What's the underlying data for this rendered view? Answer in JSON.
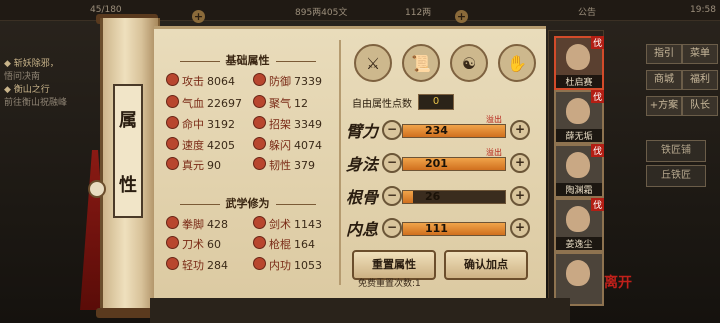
{
  "topbar": {
    "left_stat": "45/180",
    "currency": "895两405文",
    "coins": "112两",
    "notice_label": "公告",
    "time": "19:58"
  },
  "quest_panel": {
    "items": [
      {
        "title": "斩妖除邪，",
        "sub": "悟问决南"
      },
      {
        "title": "衡山之行",
        "sub": "前往衡山祝融峰"
      }
    ]
  },
  "scroll_title": [
    "属",
    "性"
  ],
  "basic_attrs": {
    "title": "基础属性",
    "left": [
      {
        "label": "攻击",
        "value": "8064"
      },
      {
        "label": "气血",
        "value": "22697"
      },
      {
        "label": "命中",
        "value": "3192"
      },
      {
        "label": "速度",
        "value": "4205"
      },
      {
        "label": "真元",
        "value": "90"
      }
    ],
    "right": [
      {
        "label": "防御",
        "value": "7339"
      },
      {
        "label": "聚气",
        "value": "12"
      },
      {
        "label": "招架",
        "value": "3349"
      },
      {
        "label": "躲闪",
        "value": "4074"
      },
      {
        "label": "韧性",
        "value": "379"
      }
    ]
  },
  "martial_attrs": {
    "title": "武学修为",
    "left": [
      {
        "label": "拳脚",
        "value": "428"
      },
      {
        "label": "刀术",
        "value": "60"
      },
      {
        "label": "轻功",
        "value": "284"
      }
    ],
    "right": [
      {
        "label": "剑术",
        "value": "1143"
      },
      {
        "label": "枪棍",
        "value": "164"
      },
      {
        "label": "内功",
        "value": "1053"
      }
    ]
  },
  "attr_icons": [
    "strength-icon",
    "scroll-book-icon",
    "taiji-icon",
    "body-icon"
  ],
  "points": {
    "label": "自由属性点数",
    "value": "0"
  },
  "bars": [
    {
      "glyph": "臂力",
      "value": "234",
      "overflow": "溢出",
      "fill_pct": 100
    },
    {
      "glyph": "身法",
      "value": "201",
      "overflow": "溢出",
      "fill_pct": 100
    },
    {
      "glyph": "根骨",
      "value": "26",
      "overflow": "",
      "fill_pct": 10
    },
    {
      "glyph": "内息",
      "value": "111",
      "overflow": "",
      "fill_pct": 100
    }
  ],
  "buttons": {
    "reset": "重置属性",
    "confirm": "确认加点",
    "free_reset": "免费重置次数:1"
  },
  "portraits": [
    {
      "name": "杜启赛",
      "tag": "伐"
    },
    {
      "name": "薛无垢",
      "tag": "伐"
    },
    {
      "name": "陶渊霜",
      "tag": "伐"
    },
    {
      "name": "姜逸尘",
      "tag": "伐"
    },
    {
      "name": "",
      "tag": ""
    }
  ],
  "seal_text": "离开",
  "menu": {
    "row1": [
      "指引",
      "菜单"
    ],
    "row2": [
      "商城",
      "福利"
    ],
    "row3": [
      "+方案",
      "队长"
    ],
    "weapons": [
      "铁匠铺",
      "丘铁匠"
    ]
  }
}
